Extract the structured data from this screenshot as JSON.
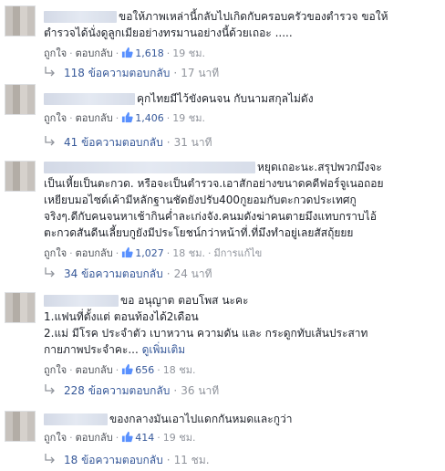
{
  "common": {
    "like_label": "ถูกใจ",
    "reply_label": "ตอบกลับ",
    "dot": "·"
  },
  "comments": [
    {
      "lines": [
        "ขอให้ภาพเหล่านี้กลับไปเกิดกับครอบครัวของตำรวจ ขอให้",
        "ตำรวจได้นั่งดูลูกเมียอย่างทรมานอย่างนี้ด้วยเถอะ ....."
      ],
      "likes": "1,618",
      "time": "19 ชม.",
      "replies": "118 ข้อความตอบกลับ",
      "reply_time": "17 นาที"
    },
    {
      "lines": [
        "คุกไทยมีไว้ขังคนจน กับนามสกุลไม่ดัง"
      ],
      "likes": "1,406",
      "time": "19 ชม.",
      "replies": "41 ข้อความตอบกลับ",
      "reply_time": "31 นาที"
    },
    {
      "lines": [
        "หยุดเถอะนะ.สรุปพวกมึงจะ",
        "เป็นเหี้ยเป็นตะกวด. หรือจะเป็นตำรวจ.เอาสักอย่างขนาดคดีฟอร์จูเนอถอย",
        "เหยียบมอไซด์เค้ามีหลักฐานชัดยังปรับ400กูยอมกับตะกวดประเทศกู",
        "จริงๆ.ดีกับคนจนหาเช้ากินค่ำละเก่งจัง.คนมดังฆ่าคนตายมึงแทบกราบไอ้",
        "ตะกวดสันดีนเลี้ยบกูยังมีประโยชน์กว่าหน้าที่.ที่มึงทำอยู่เลยสัสถุ้ยยย"
      ],
      "likes": "1,027",
      "time": "18 ชม.",
      "edited": "มีการแก้ไข",
      "replies": "34 ข้อความตอบกลับ",
      "reply_time": "24 นาที"
    },
    {
      "lines": [
        "ขอ อนุญาต ตอบโพส นะคะ",
        "1.แฟนที่ตั้งแต่ ตอนท้องได้2เดือน",
        "2.แม่ มีโรค ประจำตัว เบาหวาน ความดัน และ กระดูกทับเส้นประสาท",
        "กายภาพประจำคะ..."
      ],
      "see_more": "ดูเพิ่มเติม",
      "likes": "656",
      "time": "18 ชม.",
      "replies": "228 ข้อความตอบกลับ",
      "reply_time": "36 นาที"
    },
    {
      "lines": [
        "ของกลางมันเอาไปแดกกันหมดและกูว่า"
      ],
      "likes": "414",
      "time": "19 ชม.",
      "replies": "18 ข้อความตอบกลับ",
      "reply_time": "11 ชม."
    }
  ]
}
